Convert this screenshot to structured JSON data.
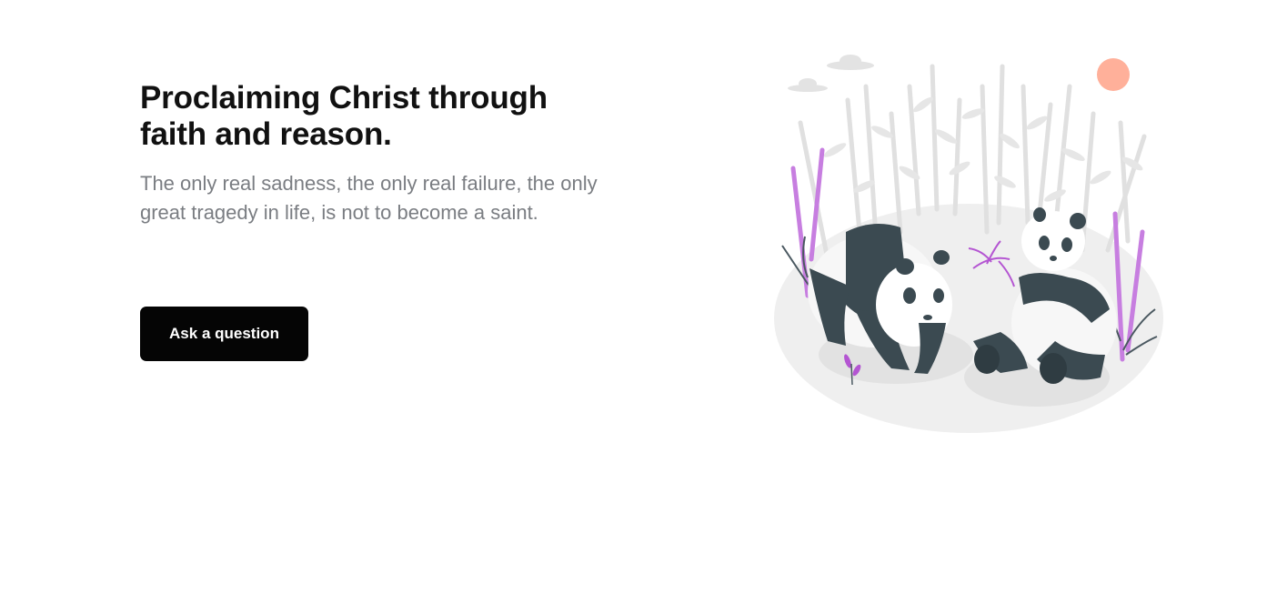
{
  "hero": {
    "title": "Proclaiming Christ through faith and reason.",
    "subtitle": "The only real sadness, the only real failure, the only great tragedy in life, is not to become a saint.",
    "cta_label": "Ask a question"
  },
  "illustration": {
    "subject": "two pandas in bamboo grove",
    "colors": {
      "accent_purple": "#b455d2",
      "sun": "#ffb09a",
      "panda_dark": "#3b4a51",
      "ground": "#ececec"
    }
  }
}
